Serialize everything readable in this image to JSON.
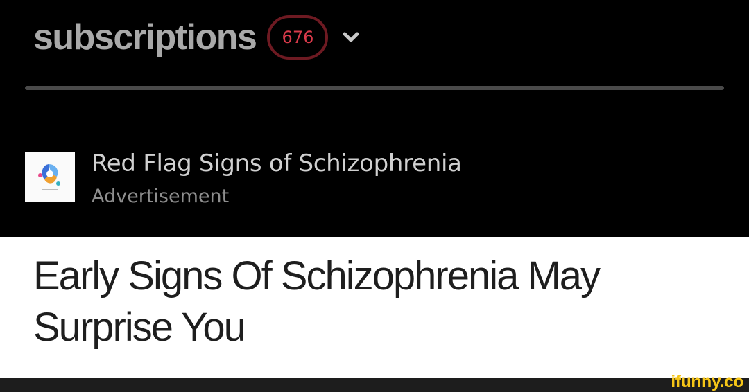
{
  "header": {
    "title": "subscriptions",
    "count": "676",
    "expand_icon": "chevron-down-icon"
  },
  "ad": {
    "thumbnail_icon": "ad-logo-icon",
    "title": "Red Flag Signs of Schizophrenia",
    "label": "Advertisement"
  },
  "article": {
    "headline": "Early Signs Of Schizophrenia May Surprise You"
  },
  "watermark": {
    "text": "ifunny.co"
  },
  "colors": {
    "background": "#000000",
    "header_text": "#a9a9a9",
    "badge_border": "#6e1a22",
    "badge_text": "#d83a4a",
    "divider": "#4a4a4a",
    "ad_title": "#d0d0d0",
    "ad_label": "#8e8e8e",
    "headline_bg": "#ffffff",
    "headline_text": "#1e1e1e",
    "watermark": "#f5c518"
  }
}
